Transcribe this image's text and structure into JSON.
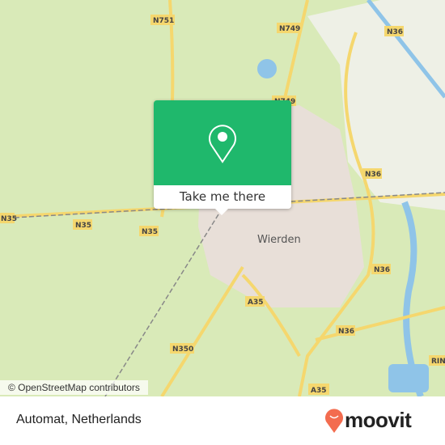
{
  "map": {
    "town_label": "Wierden",
    "road_labels": [
      "N751",
      "N749",
      "N36",
      "N749",
      "N36",
      "N35",
      "N35",
      "N35",
      "N36",
      "A35",
      "N36",
      "N350",
      "A35",
      "RIN"
    ],
    "colors": {
      "land": "#d9eab8",
      "town": "#e8dfd8",
      "water": "#8fc4e8",
      "road": "#f5d76e",
      "popup": "#1fb86c"
    },
    "attribution": "© OpenStreetMap contributors"
  },
  "popup": {
    "icon": "map-pin-icon",
    "button_label": "Take me there"
  },
  "footer": {
    "place_name": "Automat, Netherlands",
    "logo_text": "moovit",
    "logo_icon": "moovit-pin-icon",
    "logo_color": "#f36c4f"
  }
}
